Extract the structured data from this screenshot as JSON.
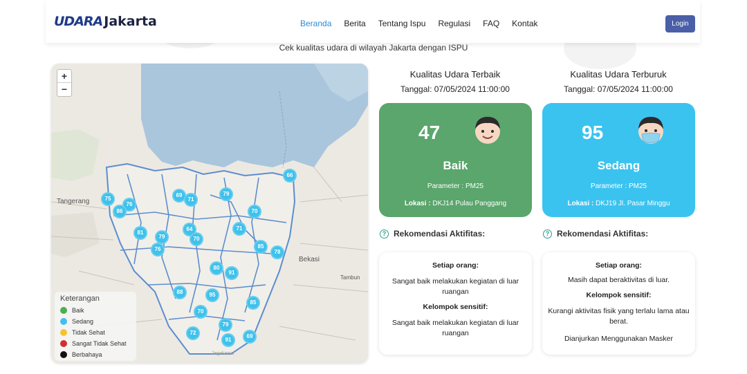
{
  "nav": {
    "brand_udara": "UDARA",
    "brand_jakarta": "Jakarta",
    "links": [
      "Beranda",
      "Berita",
      "Tentang Ispu",
      "Regulasi",
      "FAQ",
      "Kontak"
    ],
    "login": "Login"
  },
  "subtitle": "Cek kualitas udara di wilayah Jakarta dengan ISPU",
  "map": {
    "zoom_in": "+",
    "zoom_out": "−",
    "place_labels": [
      "Tangerang",
      "Bekasi",
      "Tambun",
      "Jagakarsa"
    ],
    "markers": [
      "66",
      "75",
      "69",
      "71",
      "79",
      "76",
      "86",
      "70",
      "64",
      "81",
      "79",
      "71",
      "70",
      "85",
      "78",
      "76",
      "80",
      "91",
      "88",
      "95",
      "85",
      "70",
      "79",
      "72",
      "91",
      "69"
    ],
    "legend": {
      "title": "Keterangan",
      "items": [
        {
          "label": "Baik",
          "color": "#4caf50"
        },
        {
          "label": "Sedang",
          "color": "#3fc1ec"
        },
        {
          "label": "Tidak Sehat",
          "color": "#f4c430"
        },
        {
          "label": "Sangat Tidak Sehat",
          "color": "#d32f2f"
        },
        {
          "label": "Berbahaya",
          "color": "#111111"
        }
      ]
    }
  },
  "best": {
    "title": "Kualitas Udara Terbaik",
    "date": "Tanggal: 07/05/2024 11:00:00",
    "value": "47",
    "category": "Baik",
    "parameter": "Parameter : PM25",
    "lokasi_label": "Lokasi :",
    "lokasi_value": "DKJ14 Pulau Panggang",
    "color": "#5aa66c",
    "face": "smile-face-icon",
    "rekom_title": "Rekomendasi Aktifitas:",
    "setiap_label": "Setiap orang:",
    "setiap_text": "Sangat baik melakukan kegiatan di luar ruangan",
    "sensitif_label": "Kelompok sensitif:",
    "sensitif_text": "Sangat baik melakukan kegiatan di luar ruangan"
  },
  "worst": {
    "title": "Kualitas Udara Terburuk",
    "date": "Tanggal: 07/05/2024 11:00:00",
    "value": "95",
    "category": "Sedang",
    "parameter": "Parameter : PM25",
    "lokasi_label": "Lokasi :",
    "lokasi_value": "DKJ19 Jl. Pasar Minggu",
    "color": "#3bc3f0",
    "face": "masked-face-icon",
    "rekom_title": "Rekomendasi Aktifitas:",
    "setiap_label": "Setiap orang:",
    "setiap_text": "Masih dapat beraktivitas di luar.",
    "sensitif_label": "Kelompok sensitif:",
    "sensitif_text": "Kurangi aktivitas fisik yang terlalu lama atau berat.",
    "extra_text": "Dianjurkan Menggunakan Masker"
  }
}
